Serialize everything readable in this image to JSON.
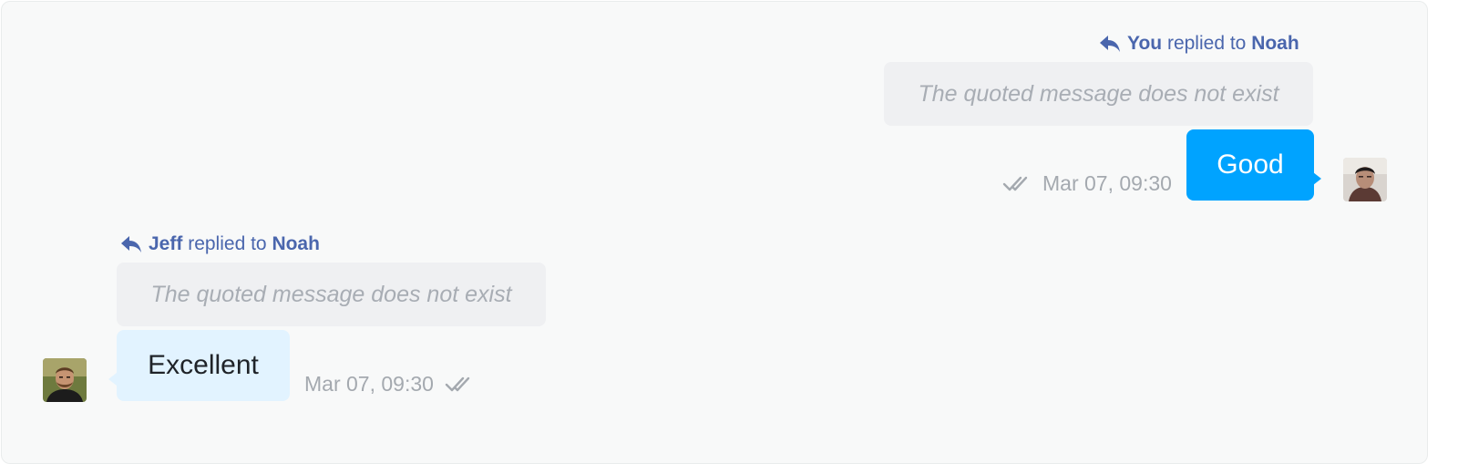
{
  "colors": {
    "panel_background": "#f8f9f9",
    "reply_header": "#4a66ad",
    "quote_background": "#eff0f2",
    "quote_text": "#a8adb4",
    "outgoing_bubble": "#00a3ff",
    "incoming_bubble": "#e2f3ff",
    "meta_text": "#a4a9af"
  },
  "messages": [
    {
      "direction": "outgoing",
      "reply": {
        "actor": "You",
        "verb": "replied to",
        "target": "Noah",
        "icon": "reply-arrow-icon"
      },
      "quote": "The quoted message does not exist",
      "text": "Good",
      "time": "Mar 07, 09:30",
      "status_icon": "double-check-icon",
      "avatar": "avatar-photo"
    },
    {
      "direction": "incoming",
      "reply": {
        "actor": "Jeff",
        "verb": "replied to",
        "target": "Noah",
        "icon": "reply-arrow-icon"
      },
      "quote": "The quoted message does not exist",
      "text": "Excellent",
      "time": "Mar 07, 09:30",
      "status_icon": "double-check-icon",
      "avatar": "avatar-photo"
    }
  ]
}
